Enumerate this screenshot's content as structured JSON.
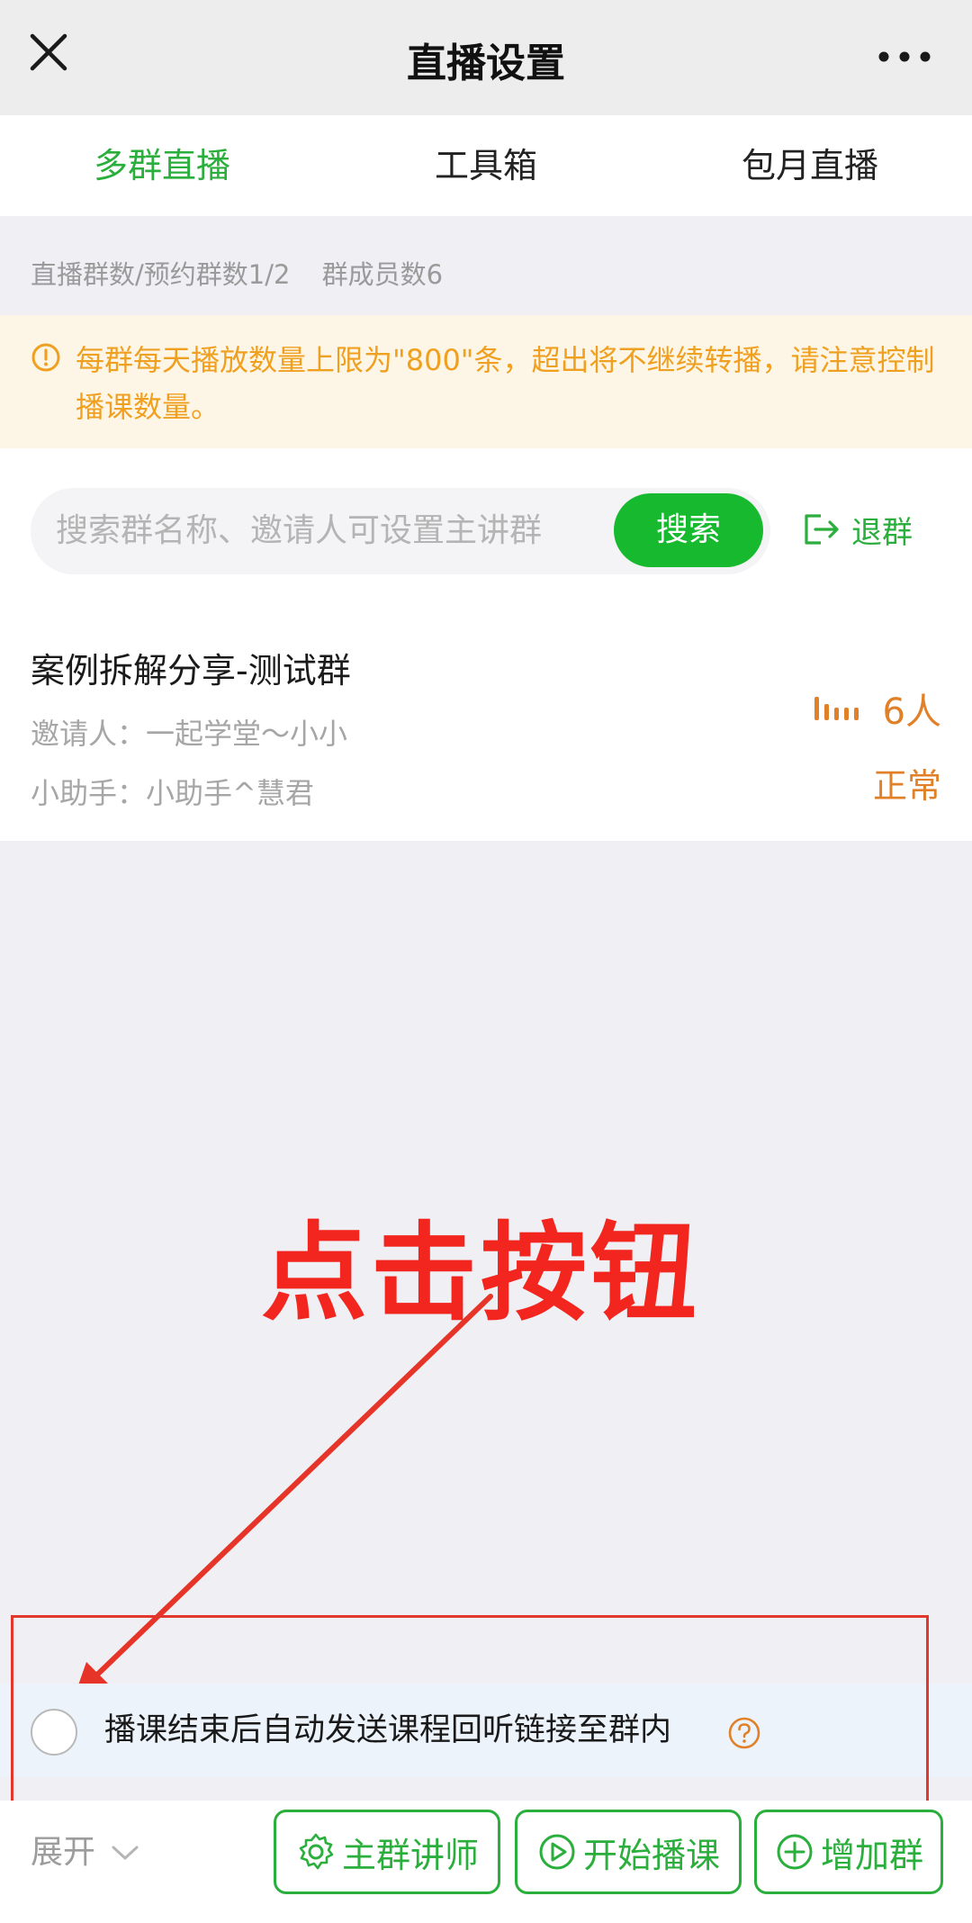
{
  "header": {
    "title": "直播设置"
  },
  "tabs": [
    {
      "label": "多群直播",
      "active": true
    },
    {
      "label": "工具箱",
      "active": false
    },
    {
      "label": "包月直播",
      "active": false
    }
  ],
  "stats": {
    "group_count": "直播群数/预约群数1/2",
    "member_count": "群成员数6"
  },
  "notice": {
    "text": "每群每天播放数量上限为\"800\"条，超出将不继续转播，请注意控制播课数量。"
  },
  "search": {
    "placeholder": "搜索群名称、邀请人可设置主讲群",
    "button_label": "搜索"
  },
  "quit": {
    "label": "退群"
  },
  "group": {
    "name": "案例拆解分享-测试群",
    "inviter": "邀请人：一起学堂～小小",
    "assistant": "小助手：小助手^慧君",
    "members": "6人",
    "status": "正常"
  },
  "annotation": {
    "text": "点击按钮"
  },
  "option": {
    "label": "播课结束后自动发送课程回听链接至群内",
    "checked": false
  },
  "bottom": {
    "expand_label": "展开",
    "teacher_label": "主群讲师",
    "start_label": "开始播课",
    "add_label": "增加群"
  },
  "colors": {
    "accent_green": "#2aae3c",
    "warning_orange": "#f0a020",
    "status_orange": "#e0812a",
    "annotation_red": "#f2261e"
  },
  "icons": [
    "close-icon",
    "more-icon",
    "warning-icon",
    "exit-icon",
    "signal-bars-icon",
    "help-icon",
    "chevron-down-icon",
    "gear-icon",
    "play-icon",
    "plus-circle-icon"
  ]
}
